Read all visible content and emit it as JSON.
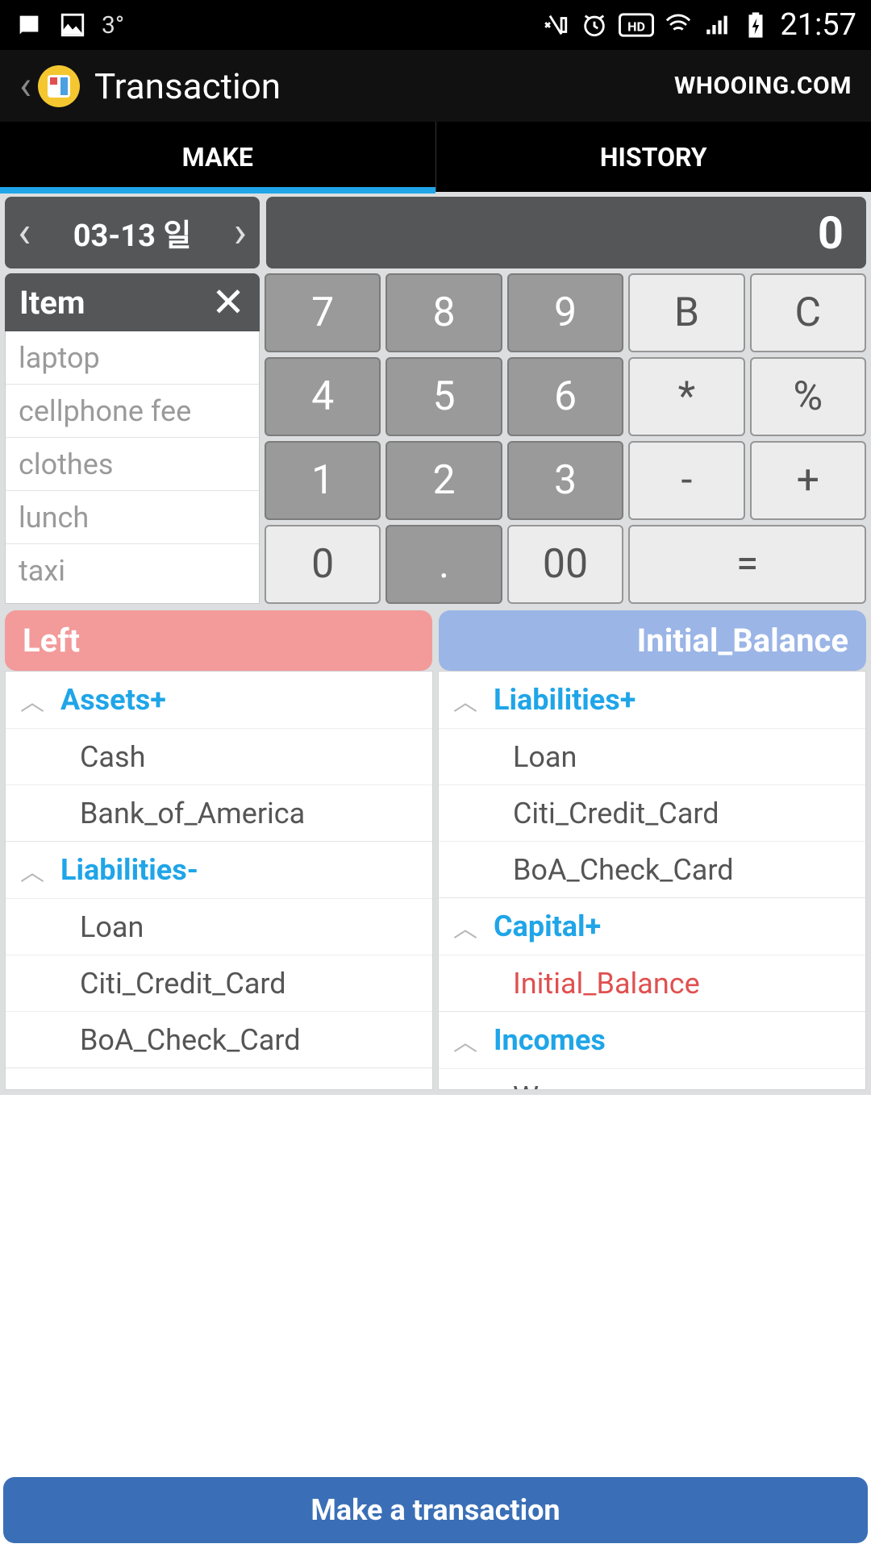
{
  "statusbar": {
    "temp": "3°",
    "time": "21:57"
  },
  "header": {
    "title": "Transaction",
    "brand": "WHOOING.COM"
  },
  "tabs": {
    "make": "MAKE",
    "history": "HISTORY"
  },
  "date": {
    "label": "03-13 일"
  },
  "amount": "0",
  "item": {
    "label": "Item",
    "options": [
      "laptop",
      "cellphone fee",
      "clothes",
      "lunch",
      "taxi"
    ]
  },
  "keypad": {
    "r1": [
      "7",
      "8",
      "9",
      "B",
      "C"
    ],
    "r2": [
      "4",
      "5",
      "6",
      "*",
      "%"
    ],
    "r3": [
      "1",
      "2",
      "3",
      "-",
      "+"
    ],
    "r4": [
      "0",
      ".",
      "00",
      "="
    ]
  },
  "picks": {
    "left": "Left",
    "right": "Initial_Balance"
  },
  "leftCol": [
    {
      "group": "Assets+",
      "items": [
        "Cash",
        "Bank_of_America"
      ]
    },
    {
      "group": "Liabilities-",
      "items": [
        "Loan",
        "Citi_Credit_Card",
        "BoA_Check_Card"
      ]
    }
  ],
  "rightCol": [
    {
      "group": "Liabilities+",
      "items": [
        "Loan",
        "Citi_Credit_Card",
        "BoA_Check_Card"
      ]
    },
    {
      "group": "Capital+",
      "items": [
        "Initial_Balance"
      ],
      "selected": "Initial_Balance"
    },
    {
      "group": "Incomes",
      "items": [
        "Wages"
      ]
    }
  ],
  "makebtn": "Make a transaction"
}
